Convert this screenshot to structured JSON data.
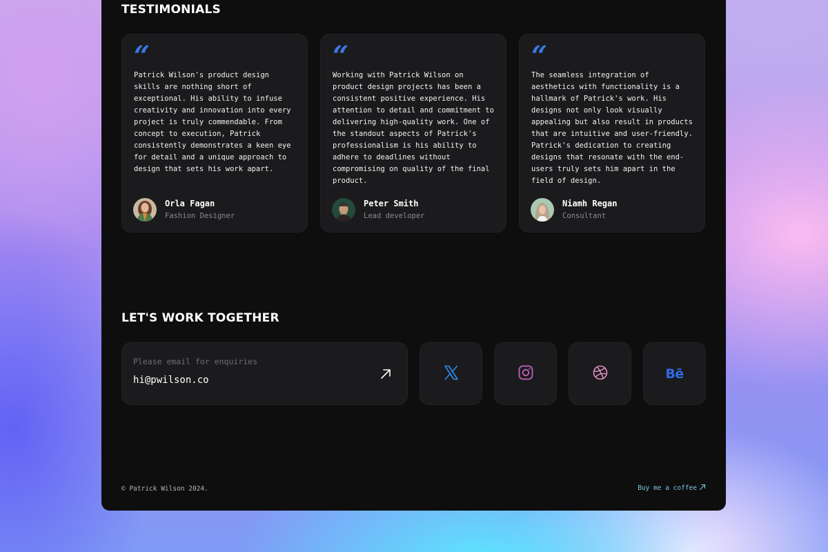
{
  "testimonials": {
    "heading": "TESTIMONIALS",
    "quote_glyph": "“",
    "items": [
      {
        "quote": "Patrick Wilson's product design skills are nothing short of exceptional. His ability to infuse creativity and innovation into every project is truly commendable. From concept to execution, Patrick consistently demonstrates a keen eye for detail and a unique approach to design that sets his work apart.",
        "name": "Orla Fagan",
        "role": "Fashion Designer"
      },
      {
        "quote": "Working with Patrick Wilson on product design projects has been a consistent positive experience. His attention to detail and commitment to delivering high-quality work. One of the standout aspects of Patrick's professionalism is his ability to adhere to deadlines without compromising on quality of the final product.",
        "name": "Peter Smith",
        "role": "Lead developer"
      },
      {
        "quote": "The seamless integration of aesthetics with functionality is a hallmark of Patrick's work. His designs not only look visually appealing but also result in products that are intuitive and user-friendly. Patrick's dedication to creating designs that resonate with the end-users truly sets him apart in the field of design.",
        "name": "Niamh Regan",
        "role": "Consultant"
      }
    ]
  },
  "contact": {
    "heading": "LET'S WORK TOGETHER",
    "email_label": "Please email for enquiries",
    "email": "hi@pwilson.co",
    "socials": [
      {
        "icon": "x-logo-icon",
        "color": "#2d8cf0"
      },
      {
        "icon": "instagram-icon",
        "color": "#c45fbf"
      },
      {
        "icon": "dribbble-icon",
        "color": "#e58fc2"
      },
      {
        "icon": "behance-icon",
        "color": "#2f6be6",
        "text": "Bē"
      }
    ]
  },
  "footer": {
    "copyright": "© Patrick Wilson 2024.",
    "coffee_label": "Buy me a coffee"
  },
  "colors": {
    "panel": "#0e0e0f",
    "card": "#1b1b1d",
    "quote_accent": "#3b78e7",
    "link": "#7cc8e6"
  }
}
